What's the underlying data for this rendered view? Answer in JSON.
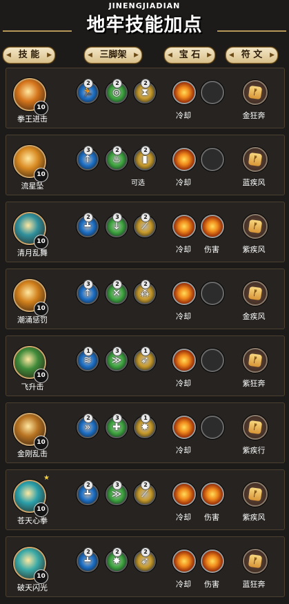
{
  "header": {
    "subtitle": "JINENGJIADIAN",
    "title": "地牢技能加点"
  },
  "tabs": [
    {
      "label": "技 能"
    },
    {
      "label": "三脚架"
    },
    {
      "label": "宝 石"
    },
    {
      "label": "符 文"
    }
  ],
  "rows": [
    {
      "skill": "拳王进击",
      "level": "10",
      "star": "",
      "tripods": [
        {
          "rank": "2",
          "icon": "runner-icon",
          "glyph": "🏃",
          "color": "#1d70c7"
        },
        {
          "rank": "2",
          "icon": "swirl-icon",
          "glyph": "◎",
          "color": "#3ea63e"
        },
        {
          "rank": "2",
          "icon": "hourglass-icon",
          "glyph": "⧗",
          "color": "#c89a2a"
        }
      ],
      "tripod_note": "",
      "gems": [
        {
          "type": "fire",
          "label": "冷却"
        },
        {
          "type": "empty",
          "label": ""
        }
      ],
      "rune": "金狂奔"
    },
    {
      "skill": "流星坠",
      "level": "10",
      "star": "",
      "tripods": [
        {
          "rank": "3",
          "icon": "arrow-up-icon",
          "glyph": "↑",
          "color": "#1d70c7"
        },
        {
          "rank": "2",
          "icon": "flame-icon",
          "glyph": "♨",
          "color": "#3ea63e"
        },
        {
          "rank": "2",
          "icon": "pillar-icon",
          "glyph": "▮",
          "color": "#c89a2a"
        }
      ],
      "tripod_note": "可选",
      "gems": [
        {
          "type": "fire",
          "label": "冷却"
        },
        {
          "type": "empty",
          "label": ""
        }
      ],
      "rune": "蓝疾风"
    },
    {
      "skill": "清月乱舞",
      "level": "10",
      "star": "",
      "tripods": [
        {
          "rank": "2",
          "icon": "sword-stand-icon",
          "glyph": "┻",
          "color": "#1d70c7"
        },
        {
          "rank": "3",
          "icon": "down-arrow-icon",
          "glyph": "↓",
          "color": "#3ea63e"
        },
        {
          "rank": "2",
          "icon": "slash-icon",
          "glyph": "⟋",
          "color": "#c89a2a"
        }
      ],
      "tripod_note": "",
      "gems": [
        {
          "type": "fire",
          "label": "冷却"
        },
        {
          "type": "fire",
          "label": "伤害"
        }
      ],
      "rune": "紫疾风"
    },
    {
      "skill": "潮涌惩罚",
      "level": "10",
      "star": "",
      "tripods": [
        {
          "rank": "3",
          "icon": "arrow-up-icon",
          "glyph": "↑",
          "color": "#1d70c7"
        },
        {
          "rank": "2",
          "icon": "crossed-arrows-icon",
          "glyph": "✕",
          "color": "#3ea63e"
        },
        {
          "rank": "2",
          "icon": "orbs-icon",
          "glyph": "⁂",
          "color": "#c89a2a"
        }
      ],
      "tripod_note": "",
      "gems": [
        {
          "type": "fire",
          "label": "冷却"
        },
        {
          "type": "empty",
          "label": ""
        }
      ],
      "rune": "金疾风"
    },
    {
      "skill": "飞升击",
      "level": "10",
      "star": "",
      "tripods": [
        {
          "rank": "1",
          "icon": "layers-icon",
          "glyph": "≋",
          "color": "#1d70c7"
        },
        {
          "rank": "3",
          "icon": "dash-icon",
          "glyph": "≫",
          "color": "#3ea63e"
        },
        {
          "rank": "1",
          "icon": "streak-icon",
          "glyph": "➶",
          "color": "#c89a2a"
        }
      ],
      "tripod_note": "",
      "gems": [
        {
          "type": "fire",
          "label": "冷却"
        },
        {
          "type": "empty",
          "label": ""
        }
      ],
      "rune": "紫狂奔"
    },
    {
      "skill": "金刚乱击",
      "level": "10",
      "star": "",
      "tripods": [
        {
          "rank": "2",
          "icon": "chevrons-icon",
          "glyph": "»",
          "color": "#1d70c7"
        },
        {
          "rank": "3",
          "icon": "plus-orb-icon",
          "glyph": "✚",
          "color": "#3ea63e"
        },
        {
          "rank": "1",
          "icon": "burst-icon",
          "glyph": "✸",
          "color": "#c89a2a"
        }
      ],
      "tripod_note": "",
      "gems": [
        {
          "type": "fire",
          "label": "冷却"
        },
        {
          "type": "empty",
          "label": ""
        }
      ],
      "rune": "紫疾行"
    },
    {
      "skill": "苍天心拳",
      "level": "10",
      "star": "★",
      "tripods": [
        {
          "rank": "2",
          "icon": "sword-stand-icon",
          "glyph": "┻",
          "color": "#1d70c7"
        },
        {
          "rank": "3",
          "icon": "dash-icon",
          "glyph": "≫",
          "color": "#3ea63e"
        },
        {
          "rank": "2",
          "icon": "slash-icon",
          "glyph": "⟋",
          "color": "#c89a2a"
        }
      ],
      "tripod_note": "",
      "gems": [
        {
          "type": "fire",
          "label": "冷却"
        },
        {
          "type": "fire",
          "label": "伤害"
        }
      ],
      "rune": "紫疾风"
    },
    {
      "skill": "破天闪光",
      "level": "10",
      "star": "",
      "tripods": [
        {
          "rank": "2",
          "icon": "sword-stand-icon",
          "glyph": "┻",
          "color": "#1d70c7"
        },
        {
          "rank": "2",
          "icon": "burst-icon",
          "glyph": "✸",
          "color": "#3ea63e"
        },
        {
          "rank": "2",
          "icon": "streak-icon",
          "glyph": "➶",
          "color": "#c89a2a"
        }
      ],
      "tripod_note": "",
      "gems": [
        {
          "type": "fire",
          "label": "冷却"
        },
        {
          "type": "fire",
          "label": "伤害"
        }
      ],
      "rune": "蓝狂奔"
    }
  ],
  "skill_icon_colors": [
    "#d5751c",
    "#d98a22",
    "#2f8f9c",
    "#d1801c",
    "#3f8a3a",
    "#b77322",
    "#2a9faa",
    "#3aa9a7"
  ],
  "rune_glyph": "ᚠ"
}
